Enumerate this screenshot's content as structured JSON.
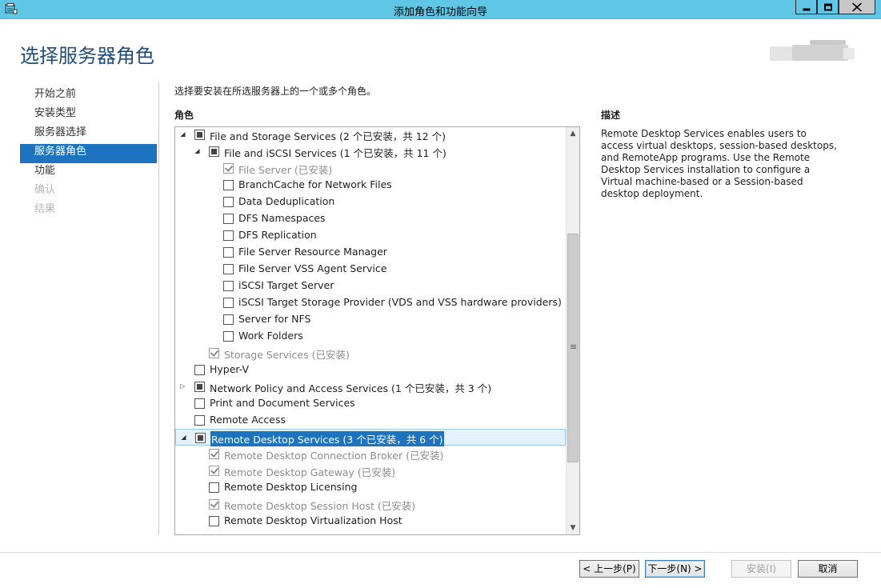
{
  "window": {
    "title": "添加角色和功能向导"
  },
  "header": {
    "page_title": "选择服务器角色"
  },
  "nav": {
    "items": [
      {
        "label": "开始之前",
        "state": "normal"
      },
      {
        "label": "安装类型",
        "state": "normal"
      },
      {
        "label": "服务器选择",
        "state": "normal"
      },
      {
        "label": "服务器角色",
        "state": "active"
      },
      {
        "label": "功能",
        "state": "normal"
      },
      {
        "label": "确认",
        "state": "disabled"
      },
      {
        "label": "结果",
        "state": "disabled"
      }
    ]
  },
  "main": {
    "instruction": "选择要安装在所选服务器上的一个或多个角色。",
    "roles_header": "角色",
    "description_header": "描述",
    "description_text": "Remote Desktop Services enables users to access virtual desktops, session-based desktops, and RemoteApp programs. Use the Remote Desktop Services installation to configure a Virtual machine-based or a Session-based desktop deployment.",
    "roles": [
      {
        "label": "File and Storage Services (2 个已安装，共 12 个)",
        "level": 0,
        "expander": "expanded",
        "check": "partial"
      },
      {
        "label": "File and iSCSI Services (1 个已安装，共 11 个)",
        "level": 1,
        "expander": "expanded",
        "check": "partial"
      },
      {
        "label": "File Server (已安装)",
        "level": 2,
        "expander": "none",
        "check": "checked",
        "installed": true
      },
      {
        "label": "BranchCache for Network Files",
        "level": 2,
        "expander": "none",
        "check": "unchecked"
      },
      {
        "label": "Data Deduplication",
        "level": 2,
        "expander": "none",
        "check": "unchecked"
      },
      {
        "label": "DFS Namespaces",
        "level": 2,
        "expander": "none",
        "check": "unchecked"
      },
      {
        "label": "DFS Replication",
        "level": 2,
        "expander": "none",
        "check": "unchecked"
      },
      {
        "label": "File Server Resource Manager",
        "level": 2,
        "expander": "none",
        "check": "unchecked"
      },
      {
        "label": "File Server VSS Agent Service",
        "level": 2,
        "expander": "none",
        "check": "unchecked"
      },
      {
        "label": "iSCSI Target Server",
        "level": 2,
        "expander": "none",
        "check": "unchecked"
      },
      {
        "label": "iSCSI Target Storage Provider (VDS and VSS hardware providers)",
        "level": 2,
        "expander": "none",
        "check": "unchecked"
      },
      {
        "label": "Server for NFS",
        "level": 2,
        "expander": "none",
        "check": "unchecked"
      },
      {
        "label": "Work Folders",
        "level": 2,
        "expander": "none",
        "check": "unchecked"
      },
      {
        "label": "Storage Services (已安装)",
        "level": 1,
        "expander": "none",
        "check": "checked",
        "installed": true
      },
      {
        "label": "Hyper-V",
        "level": 0,
        "expander": "none",
        "check": "unchecked"
      },
      {
        "label": "Network Policy and Access Services (1 个已安装，共 3 个)",
        "level": 0,
        "expander": "collapsed",
        "check": "partial"
      },
      {
        "label": "Print and Document Services",
        "level": 0,
        "expander": "none",
        "check": "unchecked"
      },
      {
        "label": "Remote Access",
        "level": 0,
        "expander": "none",
        "check": "unchecked"
      },
      {
        "label": "Remote Desktop Services (3 个已安装，共 6 个)",
        "level": 0,
        "expander": "expanded",
        "check": "partial",
        "selected": true
      },
      {
        "label": "Remote Desktop Connection Broker (已安装)",
        "level": 1,
        "expander": "none",
        "check": "checked",
        "installed": true
      },
      {
        "label": "Remote Desktop Gateway (已安装)",
        "level": 1,
        "expander": "none",
        "check": "checked",
        "installed": true
      },
      {
        "label": "Remote Desktop Licensing",
        "level": 1,
        "expander": "none",
        "check": "unchecked"
      },
      {
        "label": "Remote Desktop Session Host (已安装)",
        "level": 1,
        "expander": "none",
        "check": "checked",
        "installed": true
      },
      {
        "label": "Remote Desktop Virtualization Host",
        "level": 1,
        "expander": "none",
        "check": "unchecked"
      }
    ]
  },
  "footer": {
    "prev_label": "< 上一步(P)",
    "next_label": "下一步(N) >",
    "install_label": "安装(I)",
    "cancel_label": "取消"
  },
  "colors": {
    "titlebar": "#5fc6e6",
    "accent": "#1e73be",
    "title_text": "#1f4e79"
  }
}
